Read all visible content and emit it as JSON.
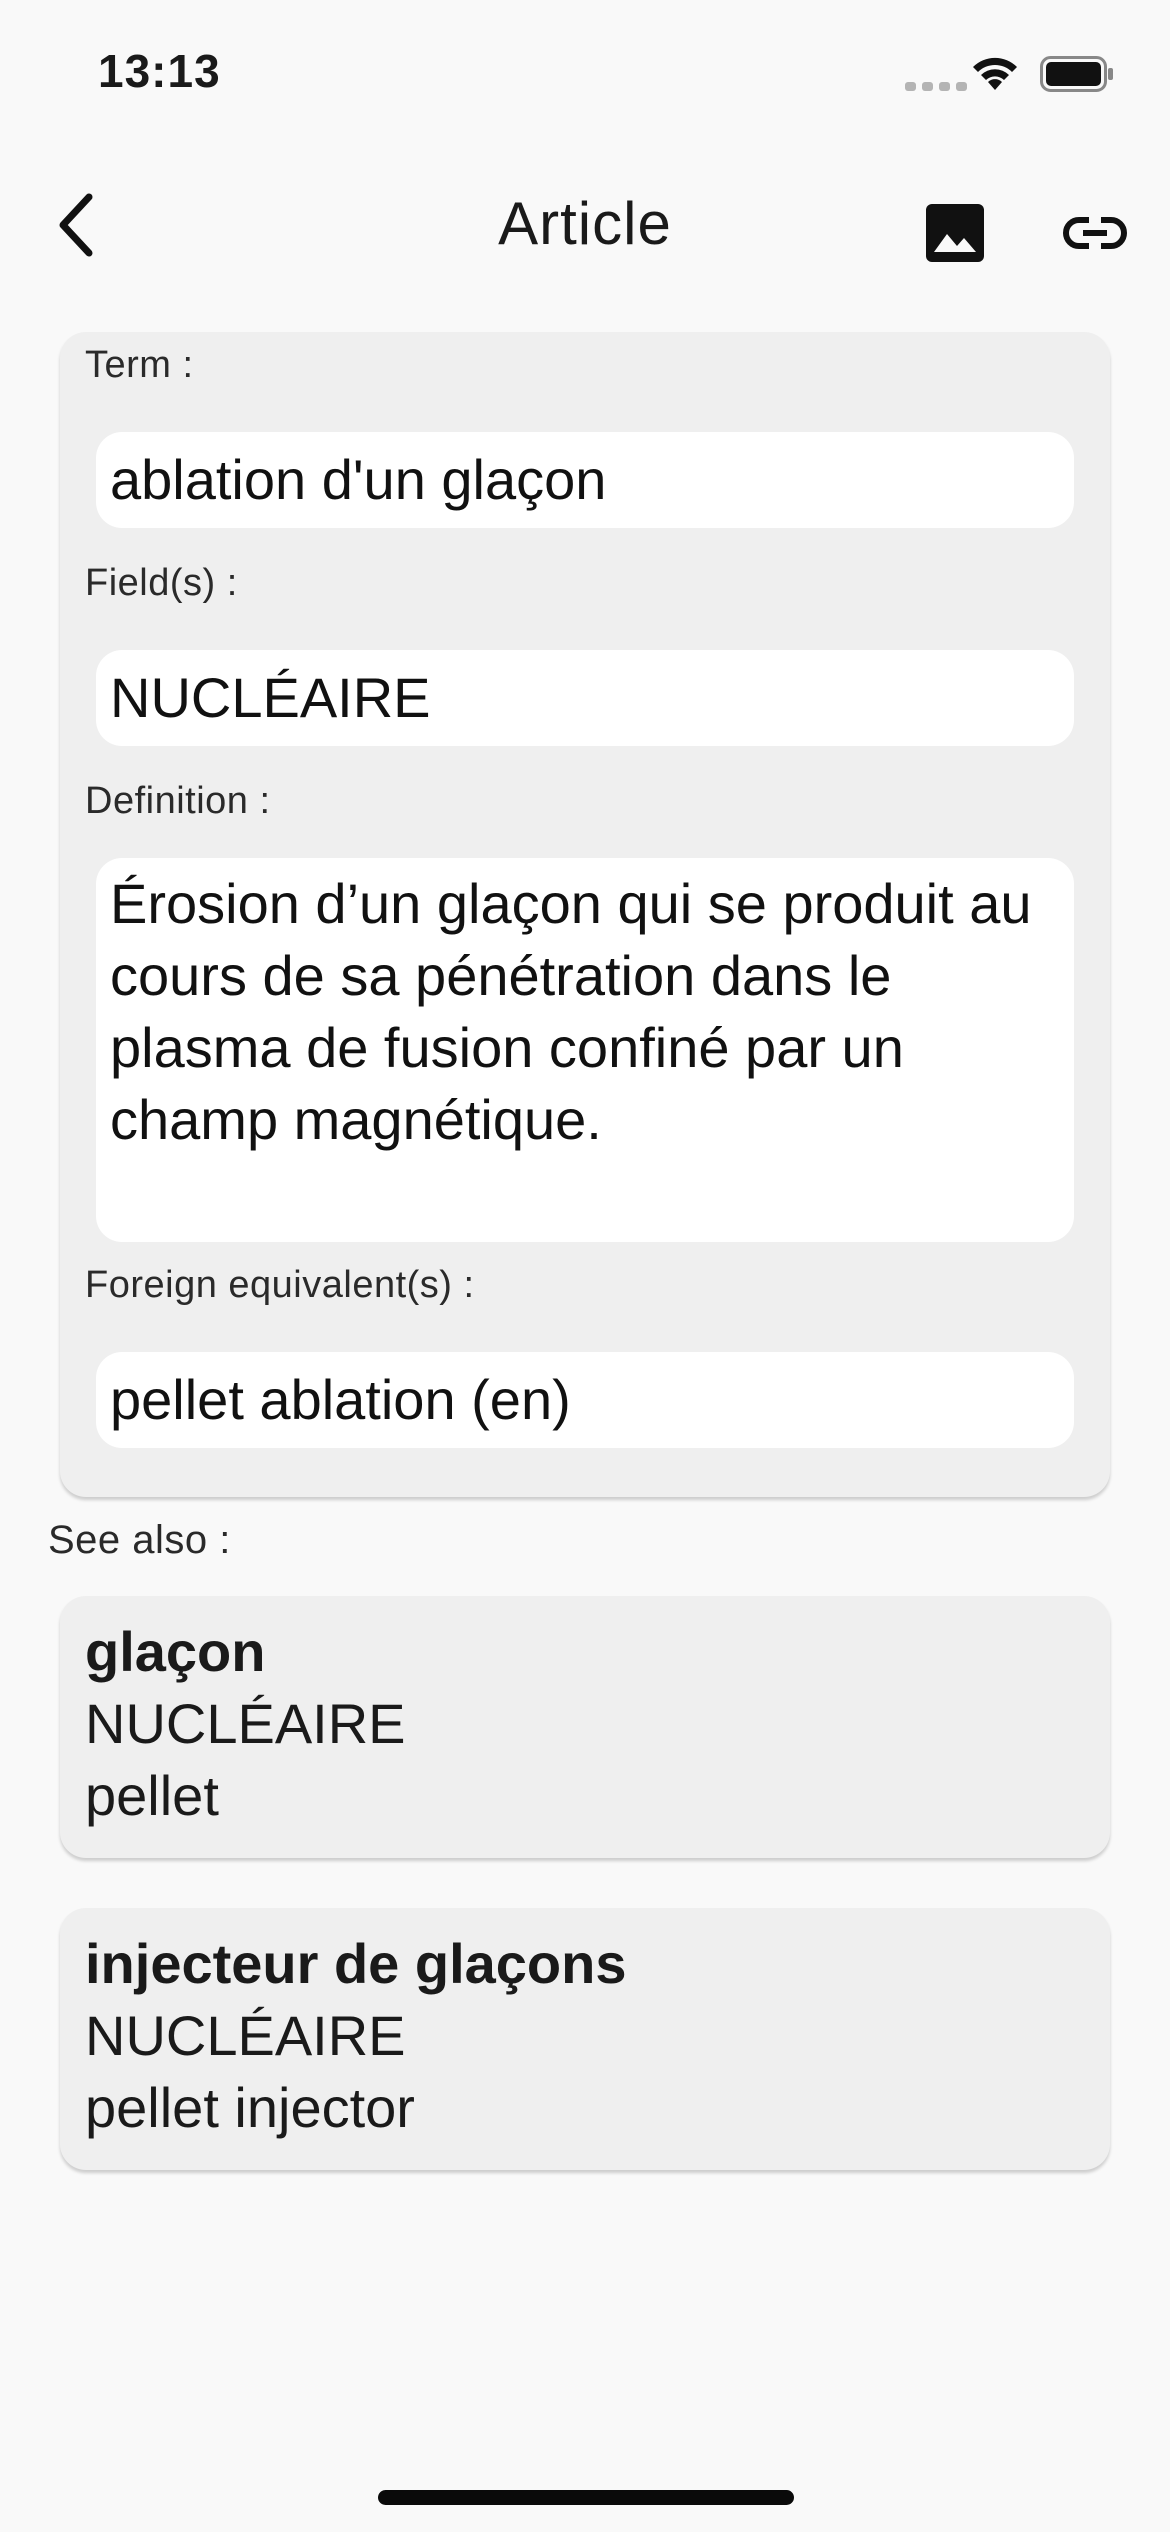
{
  "status_bar": {
    "time": "13:13"
  },
  "nav": {
    "title": "Article"
  },
  "article": {
    "term_label": "Term :",
    "term_value": "ablation d'un glaçon",
    "field_label": "Field(s) :",
    "field_value": "NUCLÉAIRE",
    "definition_label": "Definition :",
    "definition_value": "Érosion d’un glaçon qui se produit au cours de sa pénétration dans le plasma de fusion confiné par un champ magnétique.",
    "foreign_label": "Foreign equivalent(s) :",
    "foreign_value": "pellet ablation (en)"
  },
  "see_also": {
    "label": "See also :",
    "items": [
      {
        "term": "glaçon",
        "field": "NUCLÉAIRE",
        "equivalent": "pellet"
      },
      {
        "term": "injecteur de glaçons",
        "field": "NUCLÉAIRE",
        "equivalent": "pellet injector"
      }
    ]
  },
  "icons": {
    "back": "chevron-left-icon",
    "image": "image-icon",
    "link": "link-icon"
  }
}
